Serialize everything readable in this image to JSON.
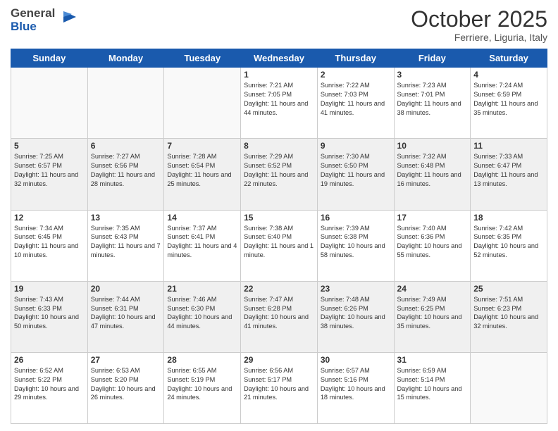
{
  "header": {
    "logo_general": "General",
    "logo_blue": "Blue",
    "month": "October 2025",
    "location": "Ferriere, Liguria, Italy"
  },
  "days_of_week": [
    "Sunday",
    "Monday",
    "Tuesday",
    "Wednesday",
    "Thursday",
    "Friday",
    "Saturday"
  ],
  "weeks": [
    [
      {
        "day": "",
        "info": ""
      },
      {
        "day": "",
        "info": ""
      },
      {
        "day": "",
        "info": ""
      },
      {
        "day": "1",
        "info": "Sunrise: 7:21 AM\nSunset: 7:05 PM\nDaylight: 11 hours and 44 minutes."
      },
      {
        "day": "2",
        "info": "Sunrise: 7:22 AM\nSunset: 7:03 PM\nDaylight: 11 hours and 41 minutes."
      },
      {
        "day": "3",
        "info": "Sunrise: 7:23 AM\nSunset: 7:01 PM\nDaylight: 11 hours and 38 minutes."
      },
      {
        "day": "4",
        "info": "Sunrise: 7:24 AM\nSunset: 6:59 PM\nDaylight: 11 hours and 35 minutes."
      }
    ],
    [
      {
        "day": "5",
        "info": "Sunrise: 7:25 AM\nSunset: 6:57 PM\nDaylight: 11 hours and 32 minutes."
      },
      {
        "day": "6",
        "info": "Sunrise: 7:27 AM\nSunset: 6:56 PM\nDaylight: 11 hours and 28 minutes."
      },
      {
        "day": "7",
        "info": "Sunrise: 7:28 AM\nSunset: 6:54 PM\nDaylight: 11 hours and 25 minutes."
      },
      {
        "day": "8",
        "info": "Sunrise: 7:29 AM\nSunset: 6:52 PM\nDaylight: 11 hours and 22 minutes."
      },
      {
        "day": "9",
        "info": "Sunrise: 7:30 AM\nSunset: 6:50 PM\nDaylight: 11 hours and 19 minutes."
      },
      {
        "day": "10",
        "info": "Sunrise: 7:32 AM\nSunset: 6:48 PM\nDaylight: 11 hours and 16 minutes."
      },
      {
        "day": "11",
        "info": "Sunrise: 7:33 AM\nSunset: 6:47 PM\nDaylight: 11 hours and 13 minutes."
      }
    ],
    [
      {
        "day": "12",
        "info": "Sunrise: 7:34 AM\nSunset: 6:45 PM\nDaylight: 11 hours and 10 minutes."
      },
      {
        "day": "13",
        "info": "Sunrise: 7:35 AM\nSunset: 6:43 PM\nDaylight: 11 hours and 7 minutes."
      },
      {
        "day": "14",
        "info": "Sunrise: 7:37 AM\nSunset: 6:41 PM\nDaylight: 11 hours and 4 minutes."
      },
      {
        "day": "15",
        "info": "Sunrise: 7:38 AM\nSunset: 6:40 PM\nDaylight: 11 hours and 1 minute."
      },
      {
        "day": "16",
        "info": "Sunrise: 7:39 AM\nSunset: 6:38 PM\nDaylight: 10 hours and 58 minutes."
      },
      {
        "day": "17",
        "info": "Sunrise: 7:40 AM\nSunset: 6:36 PM\nDaylight: 10 hours and 55 minutes."
      },
      {
        "day": "18",
        "info": "Sunrise: 7:42 AM\nSunset: 6:35 PM\nDaylight: 10 hours and 52 minutes."
      }
    ],
    [
      {
        "day": "19",
        "info": "Sunrise: 7:43 AM\nSunset: 6:33 PM\nDaylight: 10 hours and 50 minutes."
      },
      {
        "day": "20",
        "info": "Sunrise: 7:44 AM\nSunset: 6:31 PM\nDaylight: 10 hours and 47 minutes."
      },
      {
        "day": "21",
        "info": "Sunrise: 7:46 AM\nSunset: 6:30 PM\nDaylight: 10 hours and 44 minutes."
      },
      {
        "day": "22",
        "info": "Sunrise: 7:47 AM\nSunset: 6:28 PM\nDaylight: 10 hours and 41 minutes."
      },
      {
        "day": "23",
        "info": "Sunrise: 7:48 AM\nSunset: 6:26 PM\nDaylight: 10 hours and 38 minutes."
      },
      {
        "day": "24",
        "info": "Sunrise: 7:49 AM\nSunset: 6:25 PM\nDaylight: 10 hours and 35 minutes."
      },
      {
        "day": "25",
        "info": "Sunrise: 7:51 AM\nSunset: 6:23 PM\nDaylight: 10 hours and 32 minutes."
      }
    ],
    [
      {
        "day": "26",
        "info": "Sunrise: 6:52 AM\nSunset: 5:22 PM\nDaylight: 10 hours and 29 minutes."
      },
      {
        "day": "27",
        "info": "Sunrise: 6:53 AM\nSunset: 5:20 PM\nDaylight: 10 hours and 26 minutes."
      },
      {
        "day": "28",
        "info": "Sunrise: 6:55 AM\nSunset: 5:19 PM\nDaylight: 10 hours and 24 minutes."
      },
      {
        "day": "29",
        "info": "Sunrise: 6:56 AM\nSunset: 5:17 PM\nDaylight: 10 hours and 21 minutes."
      },
      {
        "day": "30",
        "info": "Sunrise: 6:57 AM\nSunset: 5:16 PM\nDaylight: 10 hours and 18 minutes."
      },
      {
        "day": "31",
        "info": "Sunrise: 6:59 AM\nSunset: 5:14 PM\nDaylight: 10 hours and 15 minutes."
      },
      {
        "day": "",
        "info": ""
      }
    ]
  ]
}
